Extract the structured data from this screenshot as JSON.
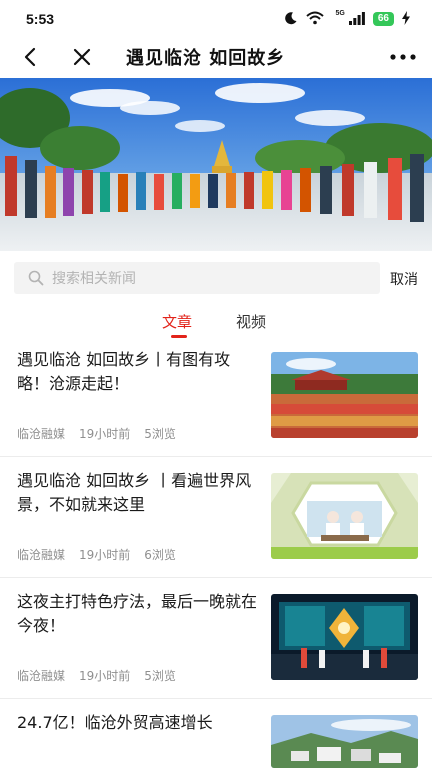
{
  "status_bar": {
    "time": "5:53",
    "network": "5G",
    "battery": "66",
    "icons": [
      "moon-icon",
      "wifi-icon",
      "signal-icon",
      "battery-icon",
      "charging-icon"
    ]
  },
  "header": {
    "title": "遇见临沧 如回故乡",
    "back_icon": "chevron-left-icon",
    "close_icon": "close-icon",
    "more_icon": "more-dots-icon"
  },
  "search": {
    "placeholder": "搜索相关新闻",
    "cancel_label": "取消"
  },
  "tabs": [
    {
      "label": "文章",
      "active": true
    },
    {
      "label": "视频",
      "active": false
    }
  ],
  "colors": {
    "accent": "#e2231a",
    "meta_text": "#8f8f8f",
    "search_bg": "#f3f3f3"
  },
  "news": [
    {
      "title": "遇见临沧 如回故乡丨有图有攻略！沧源走起！",
      "source": "临沧融媒",
      "time": "19小时前",
      "views": "5浏览"
    },
    {
      "title": "遇见临沧 如回故乡 丨看遍世界风景，不如就来这里",
      "source": "临沧融媒",
      "time": "19小时前",
      "views": "6浏览"
    },
    {
      "title": "这夜主打特色疗法，最后一晚就在今夜！",
      "source": "临沧融媒",
      "time": "19小时前",
      "views": "5浏览"
    },
    {
      "title": "24.7亿！临沧外贸高速增长",
      "source": "",
      "time": "",
      "views": ""
    }
  ]
}
